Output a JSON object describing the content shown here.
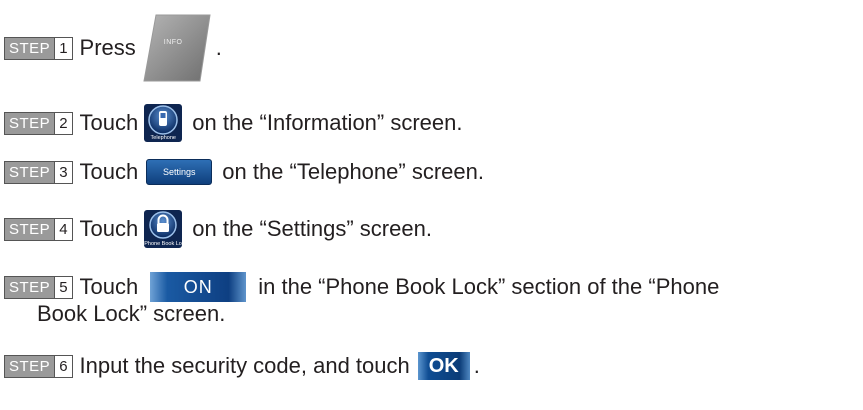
{
  "steps": [
    {
      "label": "STEP",
      "number": "1",
      "before": "Press",
      "after": "."
    },
    {
      "label": "STEP",
      "number": "2",
      "before": "Touch",
      "after": "on the “Information” screen."
    },
    {
      "label": "STEP",
      "number": "3",
      "before": "Touch",
      "after": "on the “Telephone” screen."
    },
    {
      "label": "STEP",
      "number": "4",
      "before": "Touch",
      "after": "on the “Settings” screen."
    },
    {
      "label": "STEP",
      "number": "5",
      "before": "Touch",
      "after": "in the “Phone Book Lock” section of the “Phone",
      "after_line2": "Book Lock” screen."
    },
    {
      "label": "STEP",
      "number": "6",
      "before": "Input the security code, and touch",
      "after": "."
    }
  ],
  "buttons": {
    "info": "INFO",
    "telephone": "Telephone",
    "settings": "Settings",
    "phone_book_lock": "Phone Book Lock",
    "on": "ON",
    "ok": "OK"
  },
  "colors": {
    "step_badge": "#9a9a9a",
    "button_blue": "#0f3f7c",
    "info_button_gray": "#8c8c8c"
  },
  "icons": {
    "info": "info-hard-button-icon",
    "telephone": "telephone-round-icon",
    "phone_book_lock": "padlock-round-icon"
  }
}
